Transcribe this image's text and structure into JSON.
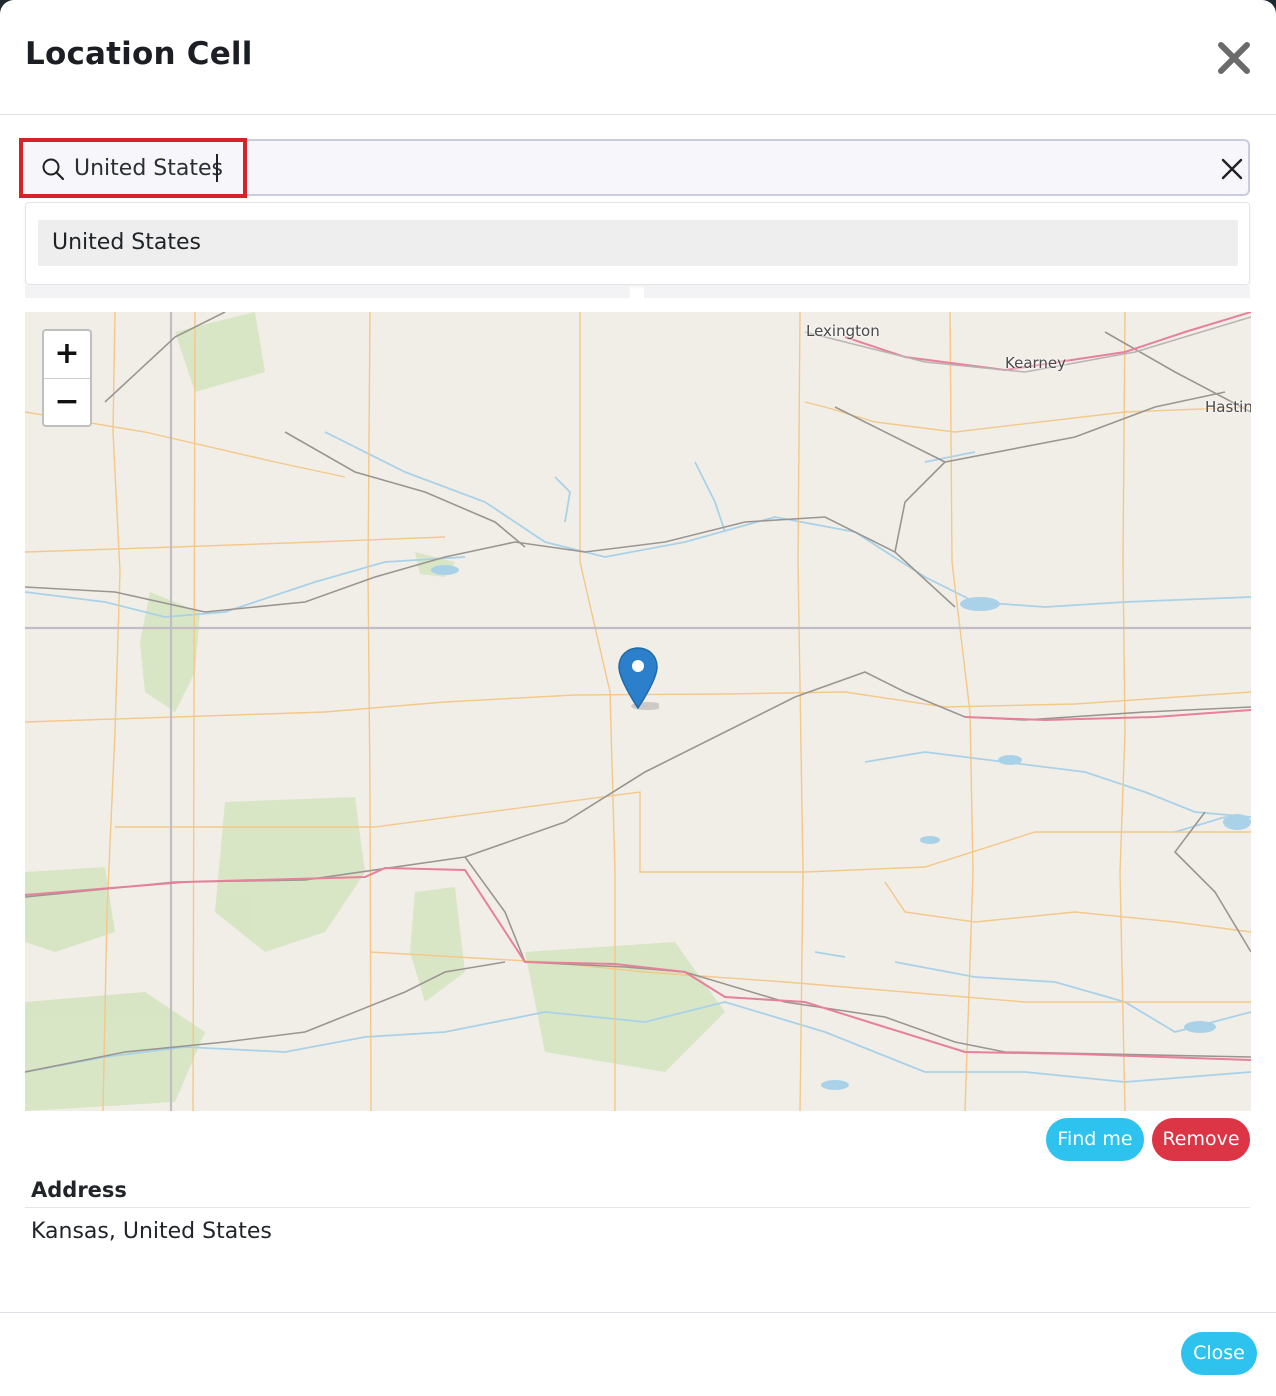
{
  "modal": {
    "title": "Location Cell",
    "close_icon": "close-icon"
  },
  "search": {
    "value": "United States",
    "icon": "search-icon",
    "clear_icon": "clear-icon"
  },
  "dropdown": {
    "items": [
      {
        "label": "United States"
      }
    ]
  },
  "map": {
    "zoom_in_label": "+",
    "zoom_out_label": "−",
    "place_labels": [
      "Lexington",
      "Kearney",
      "Hastin"
    ],
    "marker_icon": "map-marker-icon"
  },
  "actions": {
    "find_me_label": "Find me",
    "remove_label": "Remove"
  },
  "address": {
    "label": "Address",
    "value": "Kansas, United States"
  },
  "footer": {
    "close_label": "Close"
  },
  "colors": {
    "accent": "#2ec3ef",
    "danger": "#dc3545",
    "highlight": "#d7222a"
  }
}
